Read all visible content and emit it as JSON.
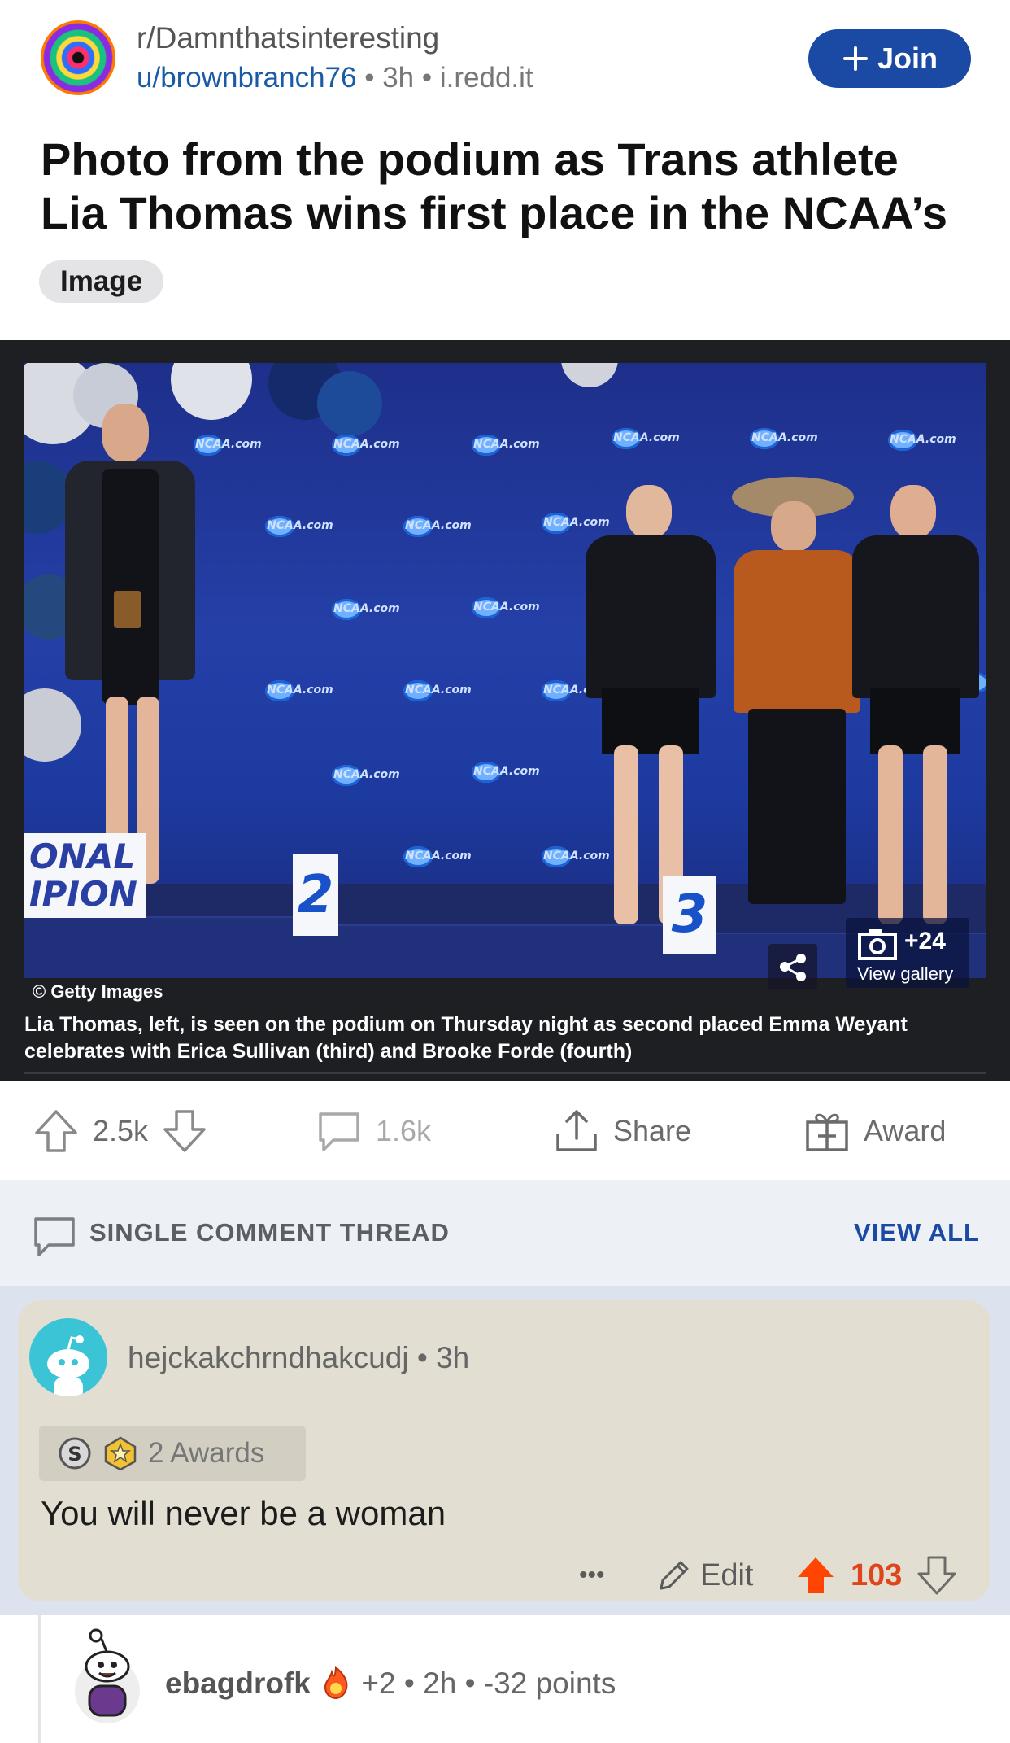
{
  "header": {
    "subreddit": "r/Damnthatsinteresting",
    "author": "u/brownbranch76",
    "separator": "•",
    "time": "3h",
    "domain": "i.redd.it",
    "join_label": "Join"
  },
  "post": {
    "title": "Photo from the podium as Trans athlete Lia Thomas wins first place in the NCAA’s",
    "flair": "Image"
  },
  "photo": {
    "credit": "© Getty Images",
    "caption": "Lia Thomas, left, is seen on the podium on Thursday night as second placed Emma Weyant celebrates with Erica Sullivan (third) and Brooke Forde (fourth)",
    "gallery_count": "+24",
    "gallery_label": "View gallery",
    "backdrop_logo_text": "NCAA.com",
    "podium_numbers": [
      "2",
      "3"
    ],
    "side_sign_lines": [
      "ONAL",
      "IPION"
    ]
  },
  "actions": {
    "upvotes": "2.5k",
    "comments": "1.6k",
    "share_label": "Share",
    "award_label": "Award"
  },
  "thread": {
    "label": "SINGLE COMMENT THREAD",
    "view_all": "VIEW ALL"
  },
  "comment": {
    "username": "hejckakchrndhakcudj",
    "time": "3h",
    "awards_label": "2 Awards",
    "body": "You will never be a woman",
    "more": "•••",
    "edit_label": "Edit",
    "score": "103"
  },
  "reply": {
    "username": "ebagdrofk",
    "extra_awards": "+2",
    "time": "2h",
    "points": "-32 points"
  },
  "colors": {
    "join_bg": "#1b4aa5",
    "upvote_active": "#ff4500",
    "link_blue": "#1a5ba6",
    "thread_bg": "#edf1f6",
    "comment_card": "#e2dfd2"
  }
}
